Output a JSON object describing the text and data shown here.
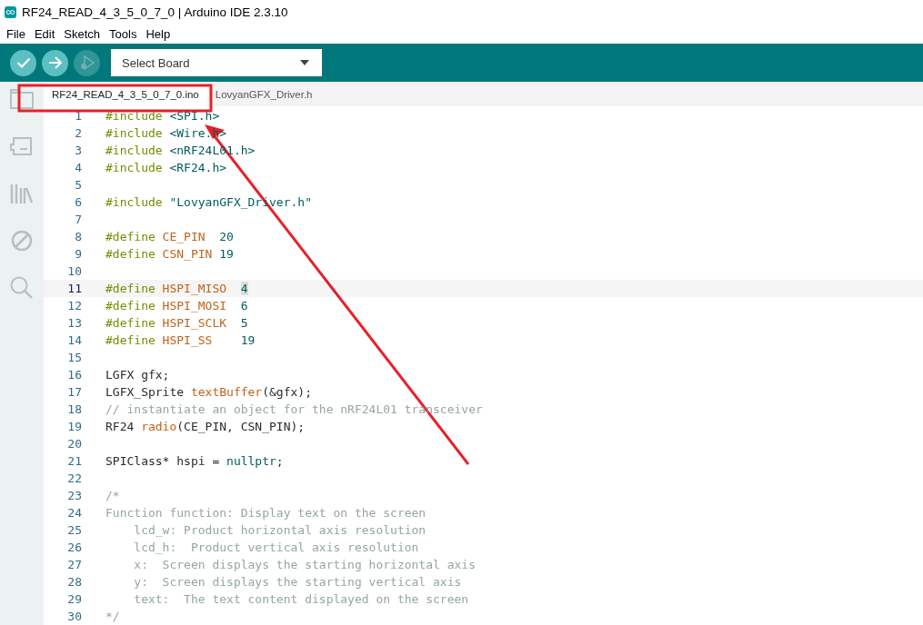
{
  "window": {
    "title": "RF24_READ_4_3_5_0_7_0 | Arduino IDE 2.3.10"
  },
  "menu": [
    "File",
    "Edit",
    "Sketch",
    "Tools",
    "Help"
  ],
  "toolbar": {
    "buttons": [
      {
        "kind": "verify",
        "disabled": false
      },
      {
        "kind": "upload",
        "disabled": false
      },
      {
        "kind": "debug",
        "disabled": true
      }
    ],
    "board_select": {
      "value": "Select Board"
    }
  },
  "sidebar": {
    "items": [
      {
        "kind": "sketchbook",
        "selected": false
      },
      {
        "kind": "boards",
        "selected": false
      },
      {
        "kind": "library",
        "selected": false
      },
      {
        "kind": "debug",
        "selected": false
      },
      {
        "kind": "search",
        "selected": false
      }
    ]
  },
  "tabs": [
    {
      "label": "RF24_READ_4_3_5_0_7_0.ino",
      "selected": true
    },
    {
      "label": "LovyanGFX_Driver.h",
      "selected": false
    }
  ],
  "editor": {
    "lines": [
      {
        "number": "1",
        "current": false,
        "tokens": [
          {
            "kind": "keyword",
            "text": "#include"
          },
          {
            "kind": "string",
            "text": " <SPI.h>"
          }
        ]
      },
      {
        "number": "2",
        "current": false,
        "tokens": [
          {
            "kind": "keyword",
            "text": "#include"
          },
          {
            "kind": "string",
            "text": " <Wire.h>"
          }
        ]
      },
      {
        "number": "3",
        "current": false,
        "tokens": [
          {
            "kind": "keyword",
            "text": "#include"
          },
          {
            "kind": "string",
            "text": " <nRF24L01.h>"
          }
        ]
      },
      {
        "number": "4",
        "current": false,
        "tokens": [
          {
            "kind": "keyword",
            "text": "#include"
          },
          {
            "kind": "string",
            "text": " <RF24.h>"
          }
        ]
      },
      {
        "number": "5",
        "current": false
      },
      {
        "number": "6",
        "current": false,
        "tokens": [
          {
            "kind": "keyword",
            "text": "#include"
          },
          {
            "kind": "string",
            "text": " \"LovyanGFX_Driver.h\""
          }
        ]
      },
      {
        "number": "7",
        "current": false
      },
      {
        "number": "8",
        "current": false,
        "tokens": [
          {
            "kind": "keyword",
            "text": "#define"
          },
          {
            "kind": "macro",
            "text": " CE_PIN"
          },
          {
            "kind": "number",
            "text": "  20"
          }
        ]
      },
      {
        "number": "9",
        "current": false,
        "tokens": [
          {
            "kind": "keyword",
            "text": "#define"
          },
          {
            "kind": "macro",
            "text": " CSN_PIN"
          },
          {
            "kind": "number",
            "text": " 19"
          }
        ]
      },
      {
        "number": "10",
        "current": false
      },
      {
        "number": "11",
        "current": true,
        "tokens": [
          {
            "kind": "keyword",
            "text": "#define"
          },
          {
            "kind": "macro",
            "text": " HSPI_MISO"
          },
          {
            "kind": "selected",
            "text": "  4"
          }
        ]
      },
      {
        "number": "12",
        "current": false,
        "tokens": [
          {
            "kind": "keyword",
            "text": "#define"
          },
          {
            "kind": "macro",
            "text": " HSPI_MOSI"
          },
          {
            "kind": "number",
            "text": "  6"
          }
        ]
      },
      {
        "number": "13",
        "current": false,
        "tokens": [
          {
            "kind": "keyword",
            "text": "#define"
          },
          {
            "kind": "macro",
            "text": " HSPI_SCLK"
          },
          {
            "kind": "number",
            "text": "  5"
          }
        ]
      },
      {
        "number": "14",
        "current": false,
        "tokens": [
          {
            "kind": "keyword",
            "text": "#define"
          },
          {
            "kind": "macro",
            "text": " HSPI_SS"
          },
          {
            "kind": "number",
            "text": "    19"
          }
        ]
      },
      {
        "number": "15",
        "current": false
      },
      {
        "number": "16",
        "current": false,
        "tokens": [
          {
            "kind": "plain",
            "text": "LGFX gfx;"
          }
        ]
      },
      {
        "number": "17",
        "current": false,
        "tokens": [
          {
            "kind": "plain",
            "text": "LGFX_Sprite "
          },
          {
            "kind": "macro",
            "text": "textBuffer"
          },
          {
            "kind": "plain",
            "text": "(&gfx);"
          }
        ]
      },
      {
        "number": "18",
        "current": false,
        "tokens": [
          {
            "kind": "comment",
            "text": "// instantiate an object for the nRF24L01 transceiver"
          }
        ]
      },
      {
        "number": "19",
        "current": false,
        "tokens": [
          {
            "kind": "plain",
            "text": "RF24 "
          },
          {
            "kind": "macro",
            "text": "radio"
          },
          {
            "kind": "plain",
            "text": "(CE_PIN, CSN_PIN);"
          }
        ]
      },
      {
        "number": "20",
        "current": false
      },
      {
        "number": "21",
        "current": false,
        "tokens": [
          {
            "kind": "plain",
            "text": "SPIClass* hspi = "
          },
          {
            "kind": "number",
            "text": "nullptr"
          },
          {
            "kind": "plain",
            "text": ";"
          }
        ]
      },
      {
        "number": "22",
        "current": false
      },
      {
        "number": "23",
        "current": false,
        "tokens": [
          {
            "kind": "comment",
            "text": "/*"
          }
        ]
      },
      {
        "number": "24",
        "current": false,
        "tokens": [
          {
            "kind": "comment",
            "text": "Function function: Display text on the screen"
          }
        ]
      },
      {
        "number": "25",
        "current": false,
        "tokens": [
          {
            "kind": "comment",
            "text": "    lcd_w: Product horizontal axis resolution"
          }
        ]
      },
      {
        "number": "26",
        "current": false,
        "tokens": [
          {
            "kind": "comment",
            "text": "    lcd_h:  Product vertical axis resolution"
          }
        ]
      },
      {
        "number": "27",
        "current": false,
        "tokens": [
          {
            "kind": "comment",
            "text": "    x:  Screen displays the starting horizontal axis"
          }
        ]
      },
      {
        "number": "28",
        "current": false,
        "tokens": [
          {
            "kind": "comment",
            "text": "    y:  Screen displays the starting vertical axis"
          }
        ]
      },
      {
        "number": "29",
        "current": false,
        "tokens": [
          {
            "kind": "comment",
            "text": "    text:  The text content displayed on the screen"
          }
        ]
      },
      {
        "number": "30",
        "current": false,
        "tokens": [
          {
            "kind": "comment",
            "text": "*/"
          }
        ]
      }
    ]
  }
}
